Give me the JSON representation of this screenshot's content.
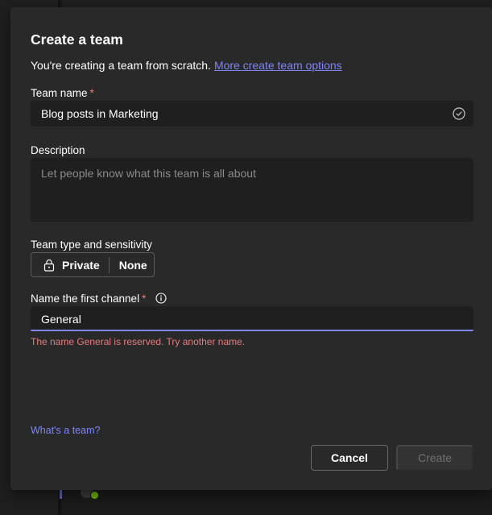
{
  "dialog": {
    "title": "Create a team",
    "intro_text": "You're creating a team from scratch.",
    "intro_link": "More create team options"
  },
  "team_name": {
    "label": "Team name",
    "required_mark": "*",
    "value": "Blog posts in Marketing",
    "icon": "check-circle-icon"
  },
  "description": {
    "label": "Description",
    "placeholder": "Let people know what this team is all about"
  },
  "team_type": {
    "label": "Team type and sensitivity",
    "privacy": "Private",
    "sensitivity": "None",
    "icon": "lock-icon"
  },
  "channel": {
    "label": "Name the first channel",
    "required_mark": "*",
    "value": "General",
    "error": "The name General is reserved. Try another name.",
    "icon": "info-icon"
  },
  "footer": {
    "help_link": "What's a team?",
    "cancel_label": "Cancel",
    "create_label": "Create"
  },
  "colors": {
    "accent": "#7f85f5",
    "error": "#e37d80",
    "dialog_bg": "#292929",
    "input_bg": "#1f1f1f"
  }
}
